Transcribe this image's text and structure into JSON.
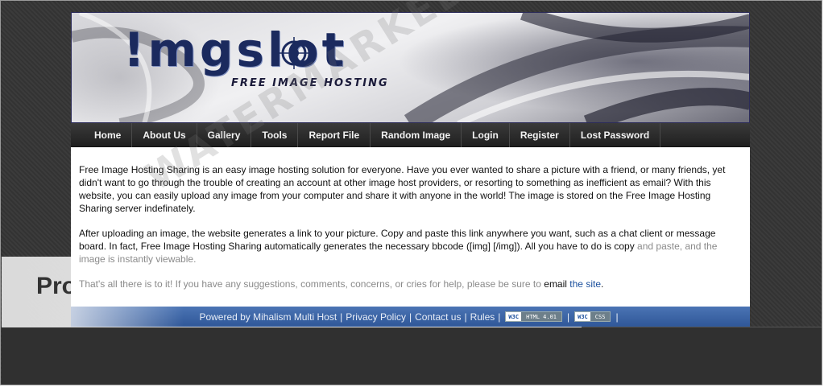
{
  "header": {
    "logo_text": "!mgslot",
    "tagline": "FREE IMAGE HOSTING"
  },
  "nav": {
    "items": [
      {
        "label": "Home"
      },
      {
        "label": "About Us"
      },
      {
        "label": "Gallery"
      },
      {
        "label": "Tools"
      },
      {
        "label": "Report File"
      },
      {
        "label": "Random Image"
      },
      {
        "label": "Login"
      },
      {
        "label": "Register"
      },
      {
        "label": "Lost Password"
      }
    ]
  },
  "content": {
    "paragraph1": "Free Image Hosting Sharing is an easy image hosting solution for everyone. Have you ever wanted to share a picture with a friend, or many friends, yet didn't want to go through the trouble of creating an account at other image host providers, or resorting to something as inefficient as email? With this website, you can easily upload any image from your computer and share it with anyone in the world! The image is stored on the Free Image Hosting Sharing server indefinately.",
    "paragraph2_main": "After uploading an image, the website generates a link to your picture. Copy and paste this link anywhere you want, such as a chat client or message board. In fact, Free Image Hosting Sharing automatically generates the necessary bbcode ([img] [/img]). All you have to do is copy",
    "paragraph2_tail": "and paste, and the image is instantly viewable.",
    "paragraph3_text": "That's all there is to it! If you have any suggestions, comments, concerns, or cries for help, please be sure to",
    "paragraph3_email": "email",
    "paragraph3_link": "the site",
    "paragraph3_end": "."
  },
  "footer": {
    "powered_by": "Powered by Mihalism Multi Host",
    "privacy": "Privacy Policy",
    "contact": "Contact us",
    "rules": "Rules",
    "sep": "|",
    "badge_html_w3": "W3C",
    "badge_html_val": "HTML 4.01",
    "badge_css_w3": "W3C",
    "badge_css_val": "CSS"
  },
  "overlay": {
    "ghost_text": "Pro",
    "watermark_text": "WATERMARKED"
  },
  "colors": {
    "nav_bg": "#2a2a2a",
    "footer_bg": "#3c65a8",
    "link": "#1a4f9c",
    "logo": "#1b2a5e"
  }
}
